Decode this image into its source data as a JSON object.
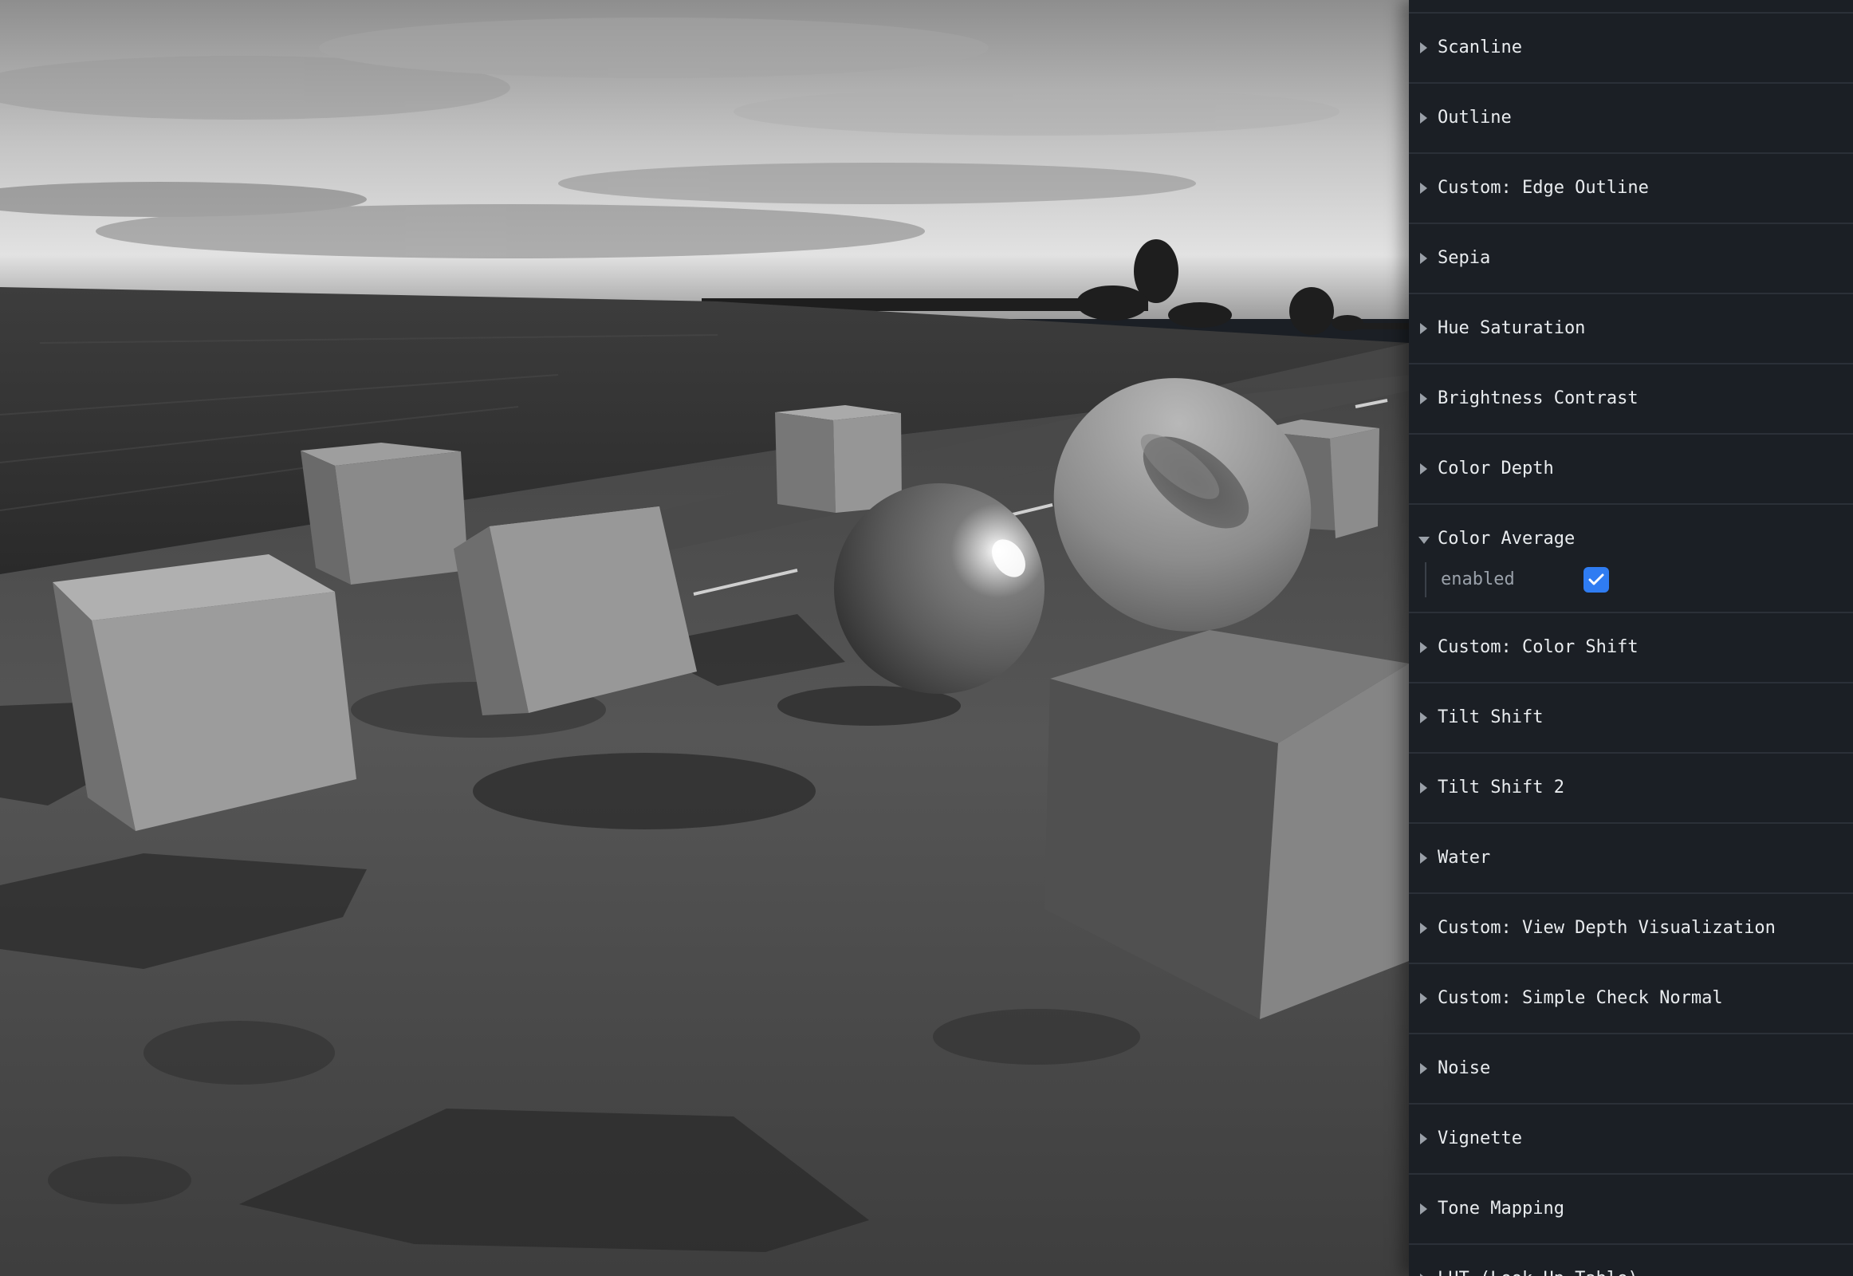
{
  "controls_panel": {
    "folders": [
      {
        "label": "Scanline"
      },
      {
        "label": "Outline"
      },
      {
        "label": "Custom: Edge Outline"
      },
      {
        "label": "Sepia"
      },
      {
        "label": "Hue Saturation"
      },
      {
        "label": "Brightness Contrast"
      },
      {
        "label": "Color Depth"
      },
      {
        "label": "Color Average",
        "expanded": true,
        "control": {
          "label": "enabled",
          "checked": true
        }
      },
      {
        "label": "Custom: Color Shift"
      },
      {
        "label": "Tilt Shift"
      },
      {
        "label": "Tilt Shift 2"
      },
      {
        "label": "Water"
      },
      {
        "label": "Custom: View Depth Visualization"
      },
      {
        "label": "Custom: Simple Check Normal"
      },
      {
        "label": "Noise"
      },
      {
        "label": "Vignette"
      },
      {
        "label": "Tone Mapping"
      },
      {
        "label": "LUT (Look Up Table)"
      }
    ]
  },
  "colors": {
    "panel_bg": "#1b1f25",
    "checkbox_accent": "#2f7cf2",
    "label_text": "#e9ecef"
  },
  "viewport": {
    "filter": "grayscale",
    "objects": [
      "cube",
      "cube",
      "cube",
      "cube",
      "cube",
      "cube",
      "metallic-sphere",
      "torus"
    ]
  }
}
